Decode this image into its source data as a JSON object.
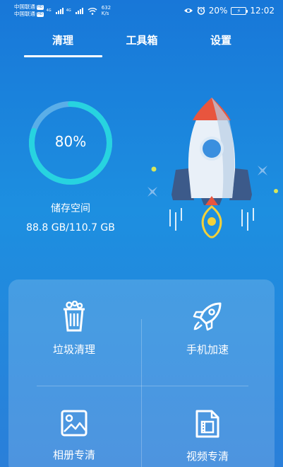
{
  "status_bar": {
    "carrier1": "中国联通",
    "carrier2": "中国联通",
    "hd": "HD",
    "net1": "4G",
    "net2": "4G",
    "speed_value": "632",
    "speed_unit": "K/s",
    "battery": "20%",
    "time": "12:02",
    "icons": [
      "eye-icon",
      "alarm-icon",
      "battery-icon",
      "wifi-icon",
      "signal-icon"
    ]
  },
  "tabs": [
    {
      "label": "清理",
      "active": true
    },
    {
      "label": "工具箱",
      "active": false
    },
    {
      "label": "设置",
      "active": false
    }
  ],
  "storage": {
    "percent_label": "80%",
    "percent": 80,
    "label": "储存空间",
    "value": "88.8 GB/110.7 GB"
  },
  "tools": [
    {
      "label": "垃圾清理",
      "icon": "trash-icon"
    },
    {
      "label": "手机加速",
      "icon": "rocket-icon"
    },
    {
      "label": "相册专清",
      "icon": "image-icon"
    },
    {
      "label": "视频专清",
      "icon": "video-file-icon"
    }
  ],
  "colors": {
    "background_top": "#1877d8",
    "ring": "#27d3e0",
    "ring_track": "#5aaee8",
    "rocket_red": "#e8553e",
    "accent_yellow": "#f2d13b"
  }
}
